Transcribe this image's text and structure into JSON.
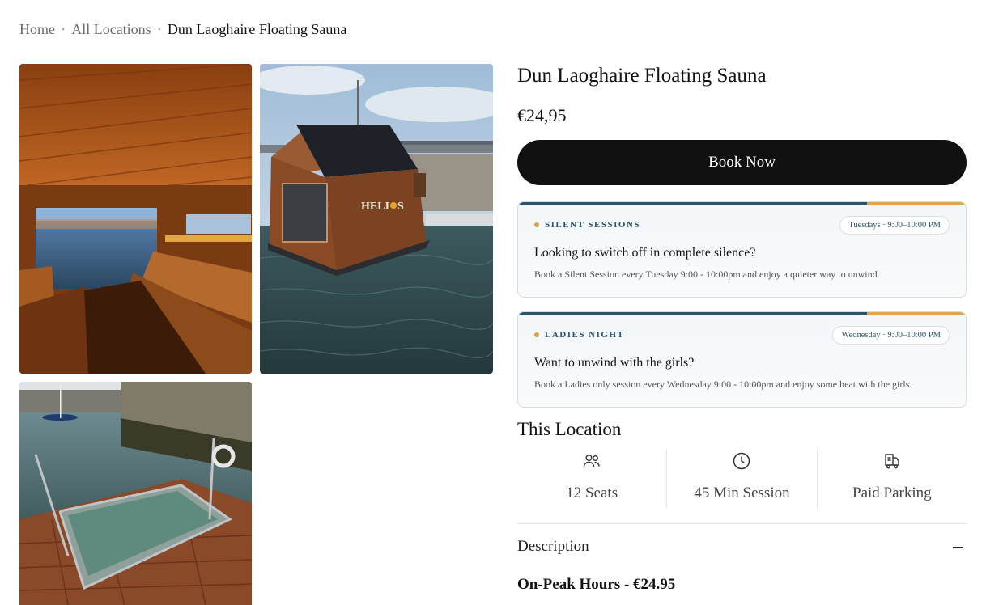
{
  "breadcrumb": {
    "home": "Home",
    "all_locations": "All Locations",
    "current": "Dun Laoghaire Floating Sauna",
    "separator": "•"
  },
  "gallery": {
    "photos": [
      {
        "name": "sauna-interior-photo"
      },
      {
        "name": "sauna-exterior-photo",
        "sign_text": "HELIOS"
      },
      {
        "name": "cold-plunge-photo"
      }
    ]
  },
  "product": {
    "title": "Dun Laoghaire Floating Sauna",
    "price": "€24,95",
    "book_label": "Book Now"
  },
  "cards": [
    {
      "tag": "SILENT SESSIONS",
      "schedule": "Tuesdays · 9:00–10:00 PM",
      "question": "Looking to switch off in complete silence?",
      "description": "Book a Silent Session every Tuesday 9:00 - 10:00pm and enjoy a quieter way to unwind."
    },
    {
      "tag": "LADIES NIGHT",
      "schedule": "Wednesday · 9:00–10:00 PM",
      "question": "Want to unwind with the girls?",
      "description": "Book a Ladies only session every Wednesday 9:00 - 10:00pm and enjoy some heat with the girls."
    }
  ],
  "location": {
    "heading": "This Location",
    "features": [
      {
        "icon": "users-icon",
        "label": "12 Seats"
      },
      {
        "icon": "clock-icon",
        "label": "45 Min Session"
      },
      {
        "icon": "parking-truck-icon",
        "label": "Paid Parking"
      }
    ]
  },
  "description": {
    "heading": "Description",
    "peak_hours": "On-Peak Hours - €24.95"
  },
  "colors": {
    "accent_navy": "#2b5468",
    "accent_gold": "#d9a851",
    "button_black": "#111111"
  }
}
